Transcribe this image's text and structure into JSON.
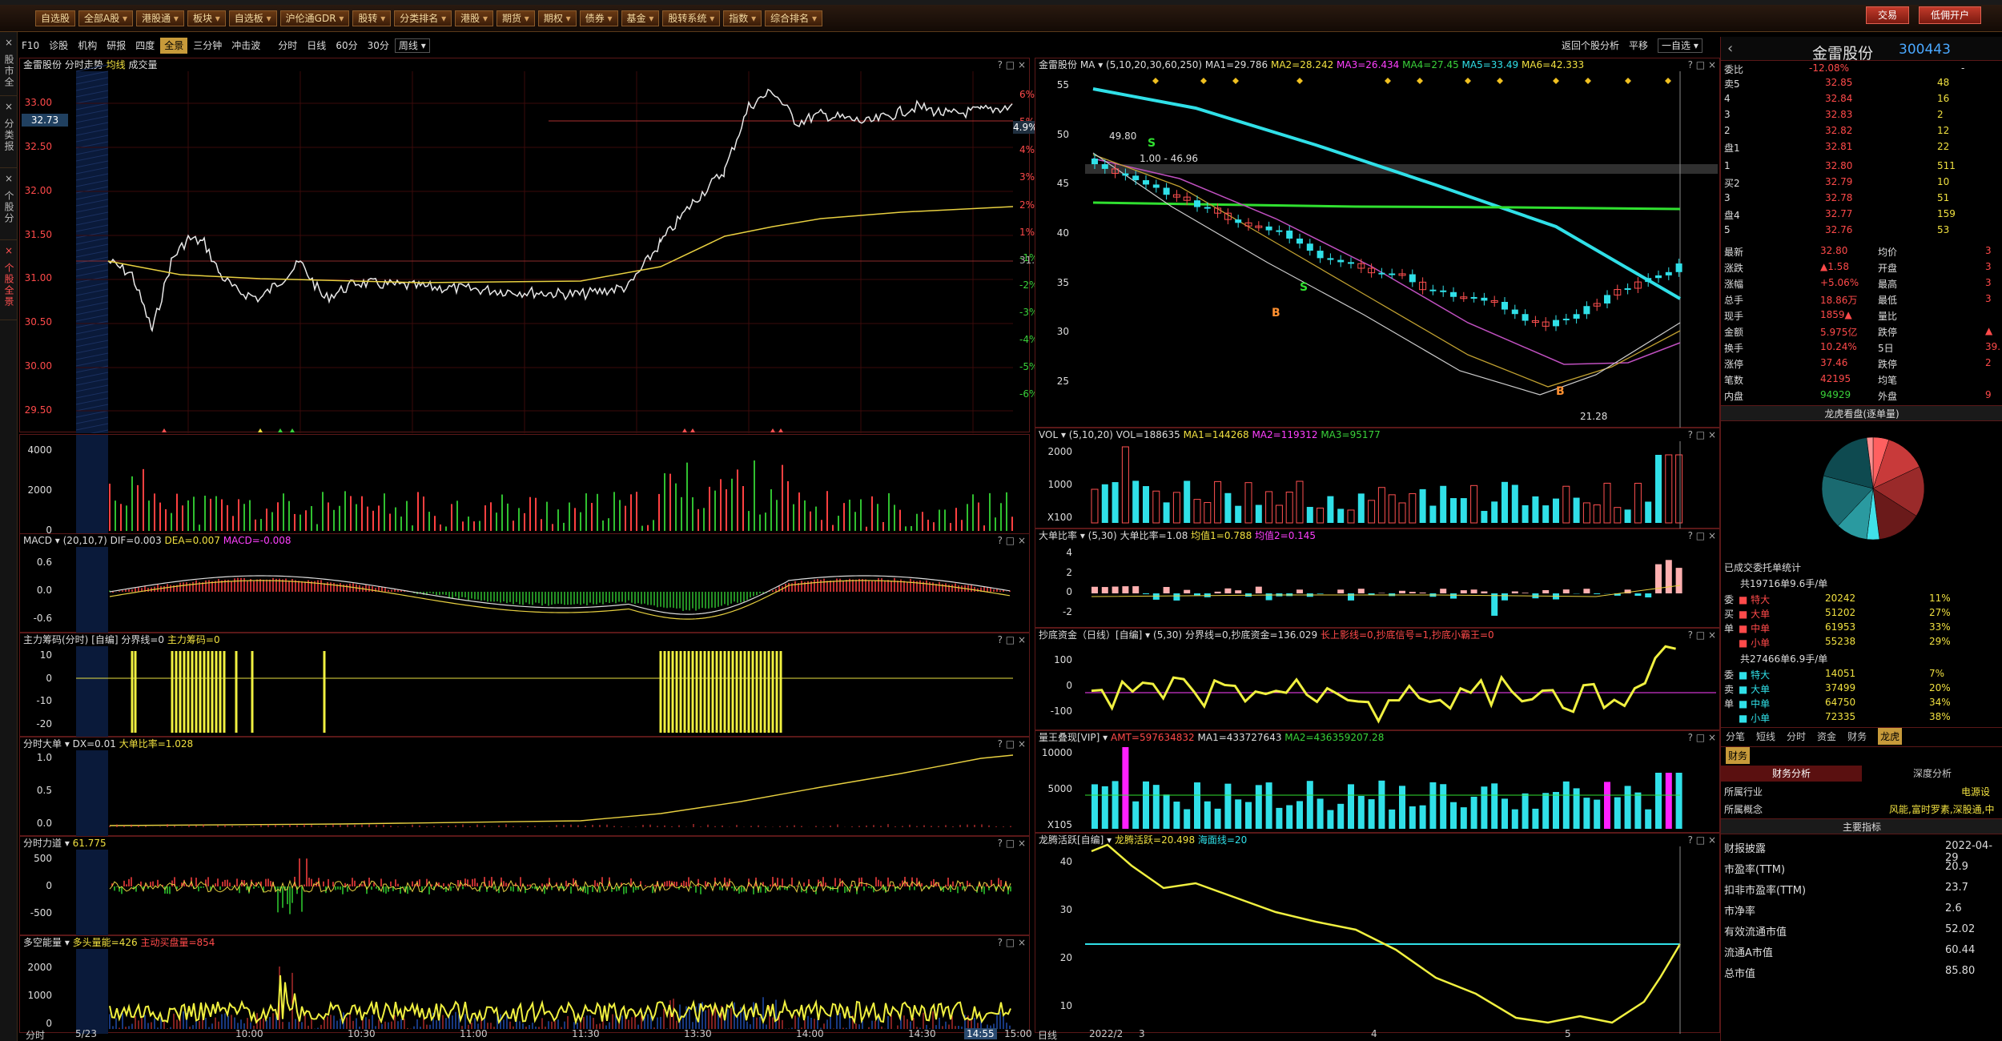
{
  "toolbar": {
    "buttons": [
      "自选股",
      "全部A股",
      "港股通",
      "板块",
      "自选板",
      "沪伦通GDR",
      "股转",
      "分类排名",
      "港股",
      "期货",
      "期权",
      "债券",
      "基金",
      "股转系统",
      "指数",
      "综合排名"
    ],
    "trade_label": "交易",
    "account_label": "低佣开户"
  },
  "left_tabs": [
    "股市全景",
    "分类报价",
    "个股分析",
    "个股全景"
  ],
  "subtool": {
    "items": [
      "F10",
      "诊股",
      "机构",
      "研报",
      "四度",
      "全景",
      "三分钟",
      "冲击波",
      "分时",
      "日线",
      "60分",
      "30分"
    ],
    "period": "周线"
  },
  "right_toolbar": {
    "back": "返回个股分析",
    "flat": "平移",
    "select": "一自选"
  },
  "intraday": {
    "header": [
      "金雷股份",
      "分时走势",
      "均线",
      "成交量"
    ],
    "price_labels": [
      "33.00",
      "32.50",
      "32.00",
      "31.50",
      "31.00",
      "30.50",
      "30.00",
      "29.50"
    ],
    "pct_labels": [
      "6%",
      "5%",
      "4%",
      "3%",
      "2%",
      "1%",
      "-1%",
      "-2%",
      "-3%",
      "-4%",
      "-5%",
      "-6%"
    ],
    "current_price": "32.73",
    "current_pct": "4.9%",
    "prev_close": "31.22",
    "vol_labels": [
      "4000",
      "2000",
      "0"
    ],
    "macd_header": {
      "name": "MACD",
      "params": "(20,10,7)",
      "dif": "DIF=0.003",
      "dea": "DEA=0.007",
      "macd": "MACD=-0.008"
    },
    "macd_labels": [
      "0.6",
      "0.0",
      "-0.6"
    ],
    "zl_header": {
      "name": "主力筹码(分时)",
      "mode": "[自编]",
      "sep": "分界线=0",
      "val": "主力筹码=0"
    },
    "zl_labels": [
      "10",
      "0",
      "-10",
      "-20"
    ],
    "dd_header": {
      "name": "分时大单",
      "dx": "DX=0.01",
      "ratio": "大单比率=1.028"
    },
    "dd_labels": [
      "1.0",
      "0.5",
      "0.0"
    ],
    "ld_header": {
      "name": "分时力道",
      "val": "61.775"
    },
    "ld_labels": [
      "500",
      "0",
      "-500"
    ],
    "dk_header": {
      "name": "多空能量",
      "bull": "多头量能=426",
      "bear": "主动买盘量=854"
    },
    "dk_labels": [
      "2000",
      "1000",
      "0"
    ],
    "time_labels": [
      "分时",
      "5/23",
      "10:00",
      "10:30",
      "11:00",
      "11:30",
      "13:30",
      "14:00",
      "14:30",
      "14:55",
      "15:00"
    ]
  },
  "kline": {
    "header": {
      "name": "金雷股份",
      "ma": "MA",
      "params": "(5,10,20,30,60,250)",
      "ma1": "MA1=29.786",
      "ma2": "MA2=28.242",
      "ma3": "MA3=26.434",
      "ma4": "MA4=27.45",
      "ma5": "MA5=33.49",
      "ma6": "MA6=42.333"
    },
    "price_labels": [
      "55",
      "50",
      "45",
      "40",
      "35",
      "30",
      "25"
    ],
    "high_label": "49.80",
    "low_label": "21.28",
    "range_label": "1.00 - 46.96",
    "vol_header": {
      "name": "VOL",
      "params": "(5,10,20)",
      "vol": "VOL=188635",
      "ma1": "MA1=144268",
      "ma2": "MA2=119312",
      "ma3": "MA3=95177"
    },
    "vol_labels": [
      "2000",
      "1000",
      "X100"
    ],
    "ddbl_header": {
      "name": "大单比率",
      "params": "(5,30)",
      "v": "大单比率=1.08",
      "ma1": "均值1=0.788",
      "ma2": "均值2=0.145"
    },
    "ddbl_labels": [
      "4",
      "2",
      "0",
      "-2"
    ],
    "cd_header": {
      "name": "抄底资金（日线）[自编]",
      "params": "(5,30)",
      "v": "分界线=0,抄底资金=136.029",
      "sig": "长上影线=0,抄底信号=1,抄底小霸王=0"
    },
    "cd_labels": [
      "100",
      "0",
      "-100"
    ],
    "lw_header": {
      "name": "量王叠现[VIP]",
      "amt": "AMT=597634832",
      "ma1": "MA1=433727643",
      "ma2": "MA2=436359207.28"
    },
    "lw_labels": [
      "10000",
      "5000",
      "X105"
    ],
    "lt_header": {
      "name": "龙腾活跃[自编]",
      "v": "龙腾活跃=20.498",
      "sea": "海面线=20"
    },
    "lt_labels": [
      "40",
      "30",
      "20",
      "10"
    ],
    "time_labels": [
      "日线",
      "2022/2",
      "3",
      "4",
      "5"
    ]
  },
  "quote": {
    "name": "金雷股份",
    "code": "300443",
    "weibi_label": "委比",
    "weibi": "-12.08%",
    "weicha": "-",
    "asks": [
      {
        "lab": "卖5",
        "price": "32.85",
        "vol": "48"
      },
      {
        "lab": "4",
        "price": "32.84",
        "vol": "16"
      },
      {
        "lab": "3",
        "price": "32.83",
        "vol": "2"
      },
      {
        "lab": "2",
        "price": "32.82",
        "vol": "12"
      },
      {
        "lab": "盘1",
        "price": "32.81",
        "vol": "22"
      }
    ],
    "bids": [
      {
        "lab": "1",
        "price": "32.80",
        "vol": "511"
      },
      {
        "lab": "买2",
        "price": "32.79",
        "vol": "10"
      },
      {
        "lab": "3",
        "price": "32.78",
        "vol": "51"
      },
      {
        "lab": "盘4",
        "price": "32.77",
        "vol": "159"
      },
      {
        "lab": "5",
        "price": "32.76",
        "vol": "53"
      }
    ],
    "stats": [
      {
        "k": "最新",
        "v": "32.80",
        "k2": "均价",
        "v2": "3"
      },
      {
        "k": "涨跌",
        "v": "▲1.58",
        "k2": "开盘",
        "v2": "3"
      },
      {
        "k": "涨幅",
        "v": "+5.06%",
        "k2": "最高",
        "v2": "3"
      },
      {
        "k": "总手",
        "v": "18.86万",
        "k2": "最低",
        "v2": "3"
      },
      {
        "k": "现手",
        "v": "1859▲",
        "k2": "量比",
        "v2": ""
      },
      {
        "k": "金额",
        "v": "5.975亿",
        "k2": "跌停",
        "v2": "▲"
      },
      {
        "k": "换手",
        "v": "10.24%",
        "k2": "5日",
        "v2": "39."
      },
      {
        "k": "涨停",
        "v": "37.46",
        "k2": "跌停",
        "v2": "2"
      },
      {
        "k": "笔数",
        "v": "42195",
        "k2": "均笔",
        "v2": ""
      },
      {
        "k": "内盘",
        "v": "94929",
        "k2": "外盘",
        "v2": "9"
      }
    ],
    "pie_title": "龙虎看盘(逐单量)",
    "done_label": "已成交委托单统计",
    "buy_total": "共19716单9.6手/单",
    "buy_rows": [
      {
        "side": "委",
        "type": "特大",
        "v": "20242",
        "p": "11%"
      },
      {
        "side": "买",
        "type": "大单",
        "v": "51202",
        "p": "27%"
      },
      {
        "side": "单",
        "type": "中单",
        "v": "61953",
        "p": "33%"
      },
      {
        "side": "",
        "type": "小单",
        "v": "55238",
        "p": "29%"
      }
    ],
    "sell_total": "共27466单6.9手/单",
    "sell_rows": [
      {
        "side": "委",
        "type": "特大",
        "v": "14051",
        "p": "7%"
      },
      {
        "side": "卖",
        "type": "大单",
        "v": "37499",
        "p": "20%"
      },
      {
        "side": "单",
        "type": "中单",
        "v": "64750",
        "p": "34%"
      },
      {
        "side": "",
        "type": "小单",
        "v": "72335",
        "p": "38%"
      }
    ],
    "tabs1": [
      "分笔",
      "短线",
      "分时",
      "资金",
      "财务",
      "龙虎"
    ],
    "tabs2": [
      "财务"
    ],
    "fin_tabs": [
      "财务分析",
      "深度分析"
    ],
    "industry_label": "所属行业",
    "industry": "电源设",
    "concept_label": "所属概念",
    "concept": "风能,富时罗素,深股通,中",
    "main_idx": "主要指标",
    "fin": [
      {
        "k": "财报披露",
        "v": "2022-04-29"
      },
      {
        "k": "市盈率(TTM)",
        "v": "20.9"
      },
      {
        "k": "扣非市盈率(TTM)",
        "v": "23.7"
      },
      {
        "k": "市净率",
        "v": "2.6"
      },
      {
        "k": "有效流通市值",
        "v": "52.02"
      },
      {
        "k": "流通A市值",
        "v": "60.44"
      },
      {
        "k": "总市值",
        "v": "85.80"
      }
    ]
  }
}
